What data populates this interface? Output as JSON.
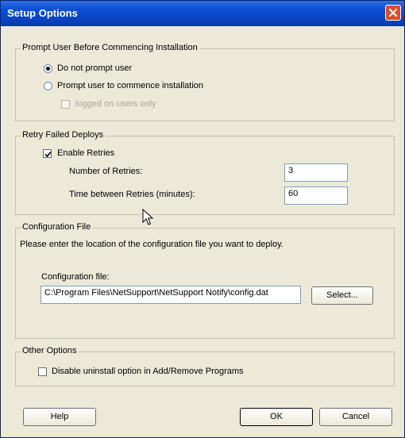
{
  "window": {
    "title": "Setup Options"
  },
  "prompt_group": {
    "legend": "Prompt User Before Commencing Installation",
    "option_no_prompt": "Do not prompt user",
    "option_prompt": "Prompt user to commence installation",
    "logged_on_only": "logged on users only",
    "selected": "Do not prompt user"
  },
  "retry_group": {
    "legend": "Retry Failed Deploys",
    "enable_label": "Enable Retries",
    "enabled": true,
    "num_retries_label": "Number of Retries:",
    "num_retries_value": "3",
    "time_between_label": "Time between Retries (minutes):",
    "time_between_value": "60"
  },
  "config_group": {
    "legend": "Configuration File",
    "description": "Please enter the location of the configuration file you want to deploy.",
    "file_label": "Configuration file:",
    "file_value": "C:\\Program Files\\NetSupport\\NetSupport Notify\\config.dat",
    "select_button": "Select..."
  },
  "other_group": {
    "legend": "Other Options",
    "disable_uninstall_label": "Disable uninstall option in Add/Remove Programs",
    "disable_uninstall_checked": false
  },
  "buttons": {
    "help": "Help",
    "ok": "OK",
    "cancel": "Cancel"
  },
  "colors": {
    "titlebar": "#0a4fd6",
    "close": "#e04b2c",
    "dialog_bg": "#ece9d8"
  },
  "icons": {
    "close": "close-icon",
    "check": "check-icon",
    "cursor": "mouse-cursor-icon"
  }
}
